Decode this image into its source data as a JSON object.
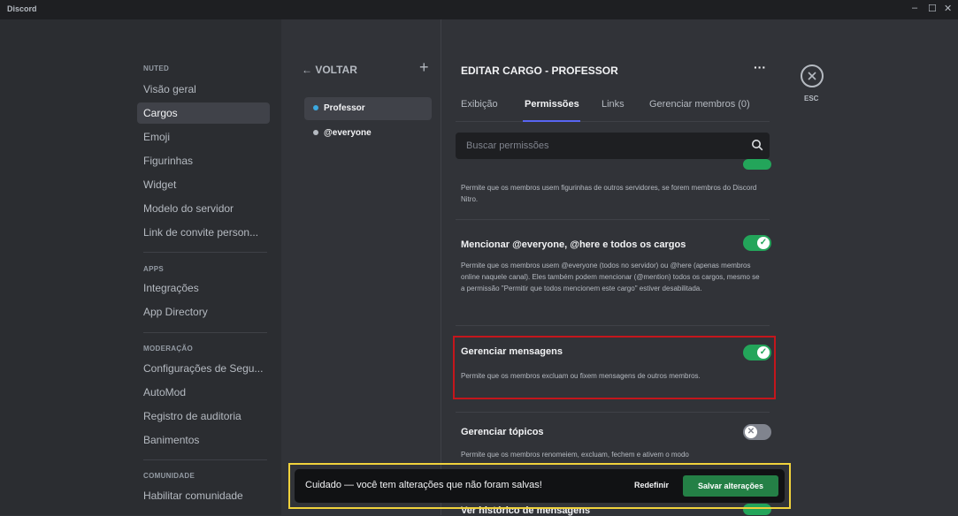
{
  "window": {
    "title": "Discord",
    "controls": [
      "–",
      "☐",
      "✕"
    ]
  },
  "sidebar": {
    "sections": [
      {
        "title": "NUTED",
        "items": [
          "Visão geral",
          "Cargos",
          "Emoji",
          "Figurinhas",
          "Widget",
          "Modelo do servidor",
          "Link de convite person..."
        ]
      },
      {
        "title": "APPS",
        "items": [
          "Integrações",
          "App Directory"
        ]
      },
      {
        "title": "MODERAÇÃO",
        "items": [
          "Configurações de Segu...",
          "AutoMod",
          "Registro de auditoria",
          "Banimentos"
        ]
      },
      {
        "title": "COMUNIDADE",
        "items": [
          "Habilitar comunidade"
        ]
      }
    ],
    "active_item": "Cargos"
  },
  "roles": {
    "back_label": "← VOLTAR",
    "add_icon": "plus-icon",
    "items": [
      {
        "name": "Professor",
        "color": "#3ba9e0",
        "active": true
      },
      {
        "name": "@everyone",
        "color": "#b5bac1",
        "active": false
      }
    ]
  },
  "editor": {
    "title": "EDITAR CARGO - PROFESSOR",
    "more_label": "···",
    "tabs": [
      "Exibição",
      "Permissões",
      "Links",
      "Gerenciar membros (0)"
    ],
    "active_tab": "Permissões",
    "search": {
      "placeholder": "Buscar permissões",
      "value": ""
    },
    "permissions": [
      {
        "title": "",
        "description": "Permite que os membros usem figurinhas de outros servidores, se forem membros do Discord Nitro.",
        "enabled": true
      },
      {
        "title": "Mencionar @everyone, @here e todos os cargos",
        "description": "Permite que os membros usem @everyone (todos no servidor) ou @here (apenas membros online naquele canal). Eles também podem mencionar (@mention) todos os cargos, mesmo se a permissão \"Permitir que todos mencionem este cargo\" estiver desabilitada.",
        "enabled": true
      },
      {
        "title": "Gerenciar mensagens",
        "description": "Permite que os membros excluam ou fixem mensagens de outros membros.",
        "enabled": true
      },
      {
        "title": "Gerenciar tópicos",
        "description": "Permite que os membros renomeiem, excluam, fechem e ativem o modo",
        "enabled": false
      },
      {
        "title": "Ver histórico de mensagens",
        "description": "",
        "enabled": true
      }
    ]
  },
  "close": {
    "label": "ESC",
    "icon": "close-icon"
  },
  "notice": {
    "text": "Cuidado — você tem alterações que não foram salvas!",
    "reset_label": "Redefinir",
    "save_label": "Salvar alterações"
  },
  "colors": {
    "accent": "#5865f2",
    "toggle_on": "#23a55a",
    "save": "#248046",
    "highlight": "#c4161c",
    "notice_outline": "#f0d23c"
  }
}
